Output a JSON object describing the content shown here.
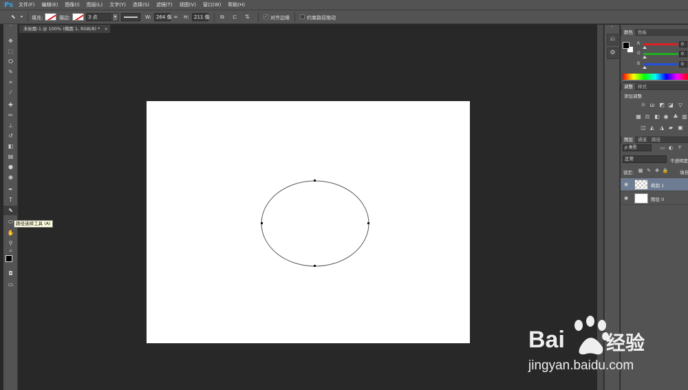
{
  "app": {
    "logo": "Ps"
  },
  "menu": [
    "文件(F)",
    "编辑(E)",
    "图像(I)",
    "图层(L)",
    "文字(Y)",
    "选择(S)",
    "滤镜(T)",
    "视图(V)",
    "窗口(W)",
    "帮助(H)"
  ],
  "options": {
    "fill_label": "填充:",
    "stroke_label": "描边:",
    "stroke_width": "3 点",
    "w_label": "W:",
    "w_value": "264 像",
    "h_label": "H:",
    "h_value": "211 像",
    "align_edges_label": "对齐边缘",
    "constrain_path_label": "约束路径拖动"
  },
  "document": {
    "tab_title": "未标题-1 @ 100% (椭圆 1, RGB/8) *",
    "close": "×"
  },
  "tooltip": "路径选择工具 (A)",
  "panels": {
    "color": {
      "tabs": [
        "颜色",
        "色板"
      ],
      "channels": [
        {
          "label": "R",
          "value": "0",
          "color": "#e02020"
        },
        {
          "label": "G",
          "value": "0",
          "color": "#20b020"
        },
        {
          "label": "B",
          "value": "0",
          "color": "#2050e0"
        }
      ]
    },
    "adjustments": {
      "tabs": [
        "调整",
        "样式"
      ],
      "add_label": "添加调整"
    },
    "layers": {
      "tabs": [
        "图层",
        "通道",
        "路径"
      ],
      "filter_label": "ρ 类型",
      "blend_mode": "正常",
      "opacity_label": "不透明度",
      "lock_label": "锁定:",
      "fill_label": "填充",
      "items": [
        {
          "name": "椭圆 1",
          "selected": true
        },
        {
          "name": "图层 0",
          "selected": false
        }
      ]
    }
  },
  "watermark": {
    "brand_latin": "Bai",
    "brand_cn": "经验",
    "url": "jingyan.baidu.com"
  }
}
